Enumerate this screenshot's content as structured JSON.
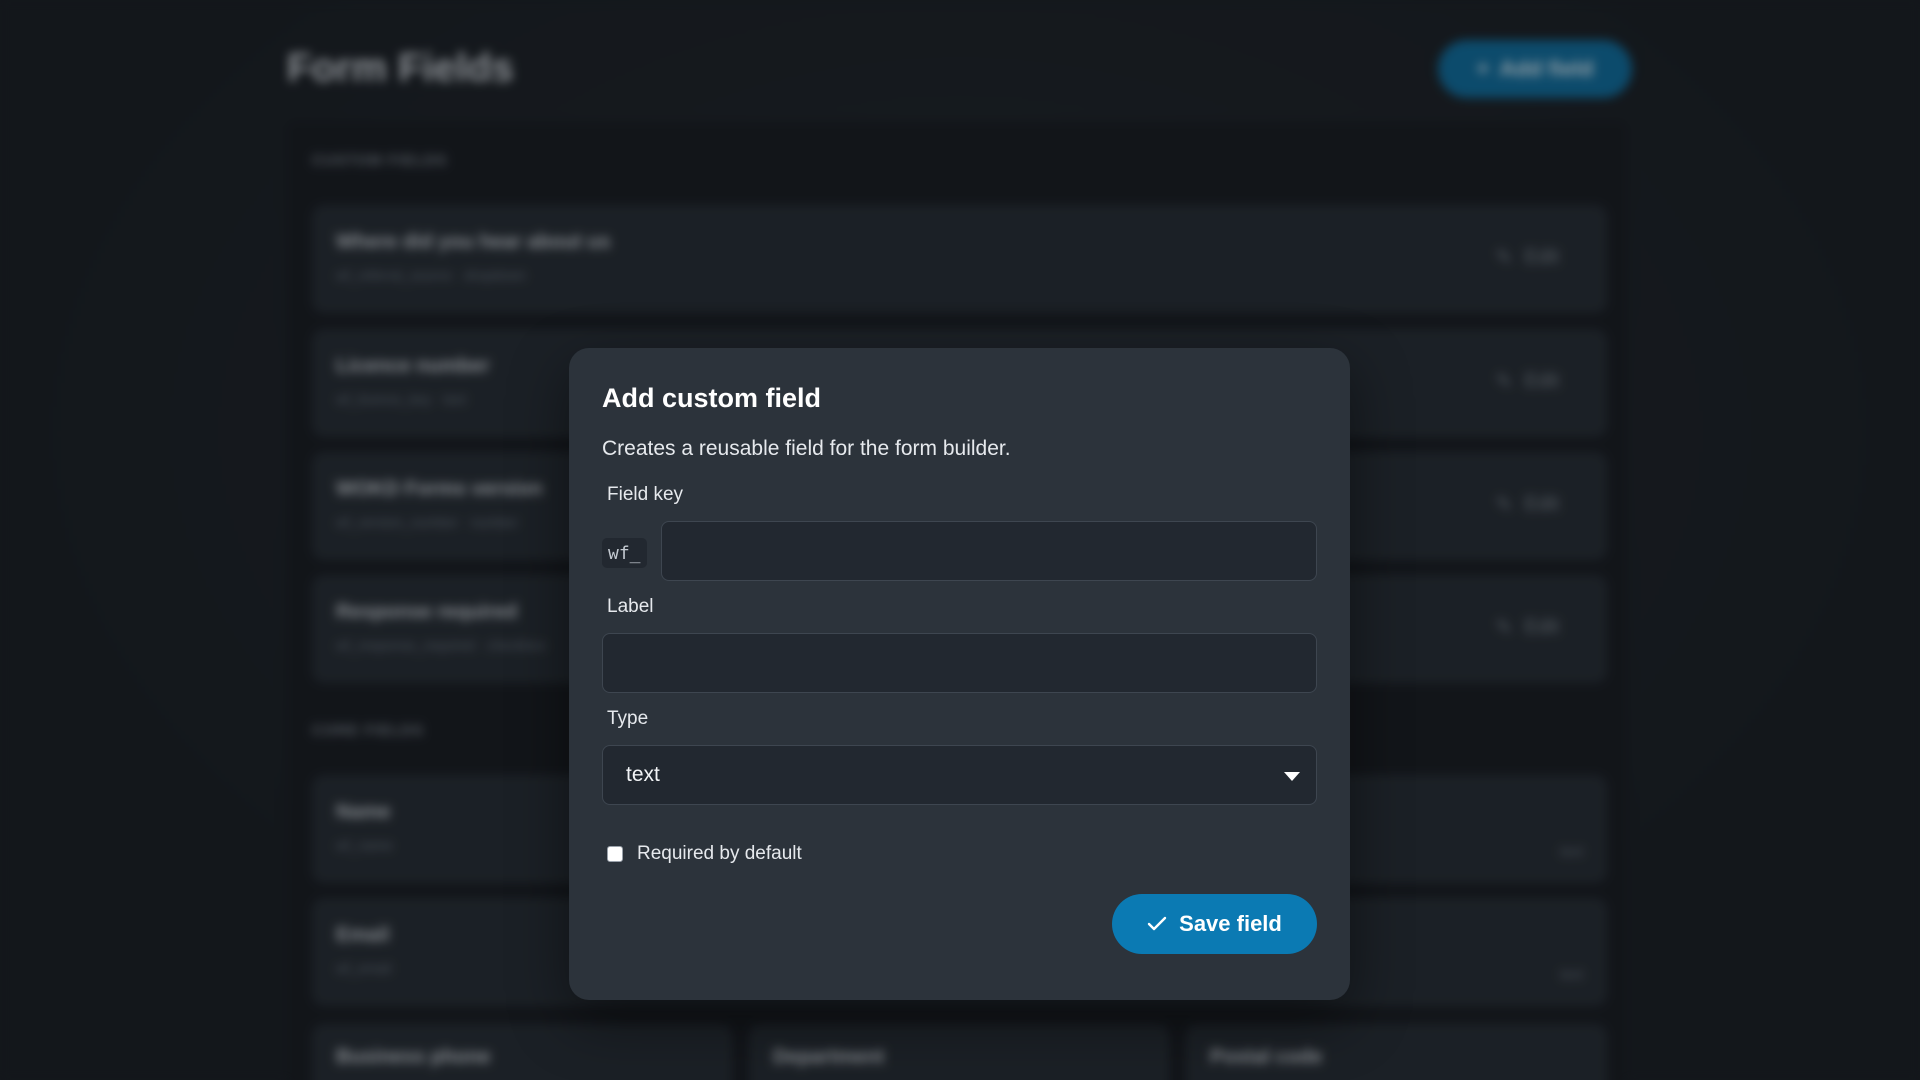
{
  "background": {
    "page_title": "Form Fields",
    "add_button_label": "Add field",
    "custom_section_title": "CUSTOM FIELDS",
    "custom_fields": [
      {
        "title": "Where did you hear about us",
        "subtitle": "wf_referral_source · dropdown",
        "edit_label": "Edit"
      },
      {
        "title": "Licence number",
        "subtitle": "wf_licence_key · text",
        "edit_label": "Edit"
      },
      {
        "title": "WOKD Forms version",
        "subtitle": "wf_version_number · number",
        "edit_label": "Edit"
      },
      {
        "title": "Response required",
        "subtitle": "wf_response_required · checkbox",
        "edit_label": "Edit"
      }
    ],
    "core_section_title": "CORE FIELDS",
    "core_fields": [
      {
        "title": "Name",
        "subtitle": "wf_name",
        "tag": "text"
      },
      {
        "title": "Email",
        "subtitle": "wf_email",
        "tag": "text"
      }
    ],
    "core_cards": [
      {
        "title": "Business phone"
      },
      {
        "title": "Department"
      },
      {
        "title": "Postal code"
      }
    ]
  },
  "modal": {
    "title": "Add custom field",
    "description": "Creates a reusable field for the form builder.",
    "field_key_label": "Field key",
    "field_key_prefix": "wf_",
    "field_key_value": "",
    "label_label": "Label",
    "label_value": "",
    "type_label": "Type",
    "type_selected": "text",
    "required_label": "Required by default",
    "required_checked": false,
    "save_label": "Save field"
  },
  "icons": {
    "plus": "plus-icon",
    "pencil": "pencil-icon",
    "check": "check-icon",
    "caret": "chevron-down-icon"
  },
  "colors": {
    "primary": "#0b7ab3",
    "modal_bg": "#2c333b",
    "input_bg": "#222830",
    "page_bg": "#1a1e23"
  }
}
